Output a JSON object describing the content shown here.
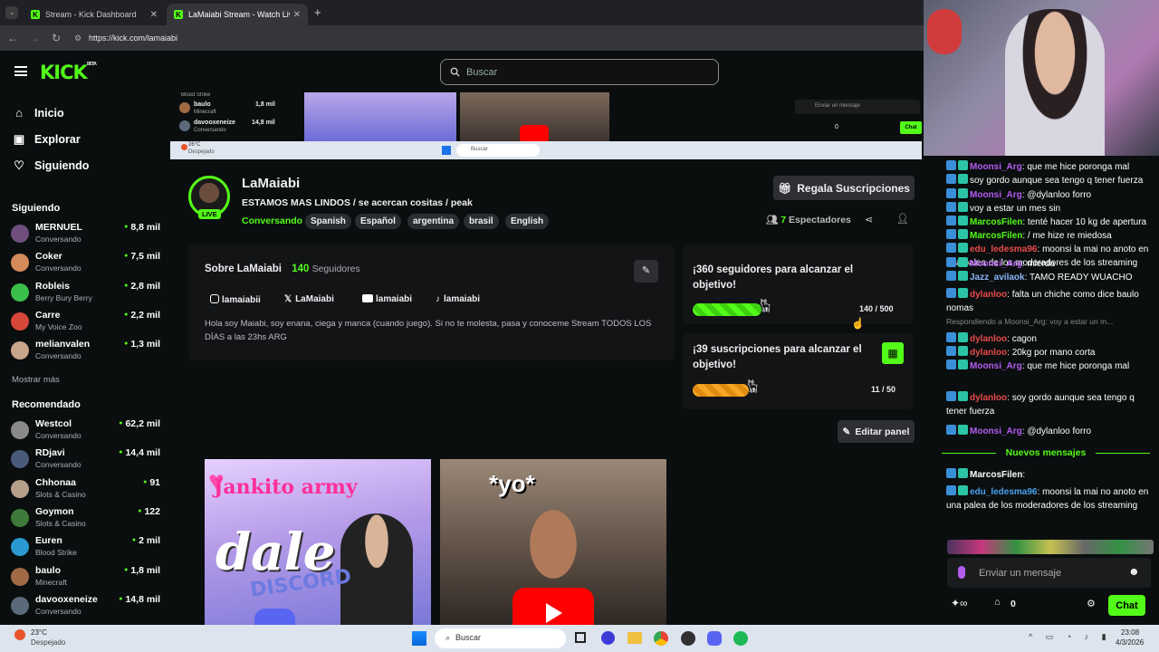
{
  "browser": {
    "tabs": [
      {
        "title": "Stream - Kick Dashboard"
      },
      {
        "title": "LaMaiabi Stream - Watch Live o"
      }
    ],
    "url": "https://kick.com/lamaiabi"
  },
  "header": {
    "logo": "KICK",
    "logo_sup": "BETA",
    "search_placeholder": "Buscar"
  },
  "nav": {
    "inicio": "Inicio",
    "explorar": "Explorar",
    "siguiendo": "Siguiendo"
  },
  "sidebar": {
    "following_title": "Siguiendo",
    "following": [
      {
        "name": "MERNUEL",
        "sub": "Conversando",
        "viewers": "8,8 mil",
        "color": "#6e4f7e"
      },
      {
        "name": "Coker",
        "sub": "Conversando",
        "viewers": "7,5 mil",
        "color": "#d58a5a"
      },
      {
        "name": "Robleis",
        "sub": "Berry Bury Berry",
        "viewers": "2,8 mil",
        "color": "#3bbf4b"
      },
      {
        "name": "Carre",
        "sub": "My Voice Zoo",
        "viewers": "2,2 mil",
        "color": "#d6473a"
      },
      {
        "name": "melianvalen",
        "sub": "Conversando",
        "viewers": "1,3 mil",
        "color": "#c9a58a"
      }
    ],
    "show_more": "Mostrar más",
    "recommended_title": "Recomendado",
    "recommended": [
      {
        "name": "Westcol",
        "sub": "Conversando",
        "viewers": "62,2 mil",
        "color": "#8a8a8a"
      },
      {
        "name": "RDjavi",
        "sub": "Conversando",
        "viewers": "14,4 mil",
        "color": "#4a5a7a"
      },
      {
        "name": "Chhonaa",
        "sub": "Slots & Casino",
        "viewers": "91",
        "color": "#b5a08a"
      },
      {
        "name": "Goymon",
        "sub": "Slots & Casino",
        "viewers": "122",
        "color": "#3e7a3a"
      },
      {
        "name": "Euren",
        "sub": "Blood Strike",
        "viewers": "2 mil",
        "color": "#2a9ad0"
      },
      {
        "name": "baulo",
        "sub": "Minecraft",
        "viewers": "1,8 mil",
        "color": "#a06a45"
      },
      {
        "name": "davooxeneize",
        "sub": "Conversando",
        "viewers": "14,8 mil",
        "color": "#5a6a7a"
      }
    ]
  },
  "inner": {
    "row1_sub": "Blood Strike",
    "row2_name": "baulo",
    "row2_sub": "Minecraft",
    "row2_vw": "1,8 mil",
    "row3_name": "davooxeneize",
    "row3_sub": "Conversando",
    "row3_vw": "14,8 mil",
    "chat_placeholder": "Enviar un mensaje",
    "chat_count": "0",
    "chat_btn": "Chat",
    "task_temp": "26°C",
    "task_weather": "Despejado",
    "task_search": "Buscar"
  },
  "stream": {
    "name": "LaMaiabi",
    "title": "ESTAMOS MAS LINDOS / se acercan cositas / peak",
    "category": "Conversando",
    "tags": [
      "Spanish",
      "Español",
      "argentina",
      "brasil",
      "English"
    ],
    "live": "LIVE",
    "gift_btn": "Regala Suscripciones",
    "viewers_count": "7",
    "viewers_label": "Espectadores"
  },
  "about": {
    "title": "Sobre LaMaiabi",
    "followers_count": "140",
    "followers_label": "Seguidores",
    "socials": [
      {
        "label": "lamaiabii"
      },
      {
        "label": "LaMaiabi"
      },
      {
        "label": "lamaiabi"
      },
      {
        "label": "lamaiabi"
      }
    ],
    "bio": "Hola soy Maiabi, soy enana, ciega y manca (cuando juego). Si no te molesta, pasa y conoceme Stream TODOS LOS DÍAS a las 23hs ARG"
  },
  "goals": [
    {
      "title": "¡360 seguidores para alcanzar el objetivo!",
      "progress": "140 / 500",
      "fraction": 0.28
    },
    {
      "title": "¡39 suscripciones para alcanzar el objetivo!",
      "progress": "11 / 50",
      "fraction": 0.22
    }
  ],
  "edit_panel": "Editar panel",
  "thumbs": [
    {
      "line1": "Jankito army",
      "line2": "dale",
      "line3": "DISCORD"
    },
    {
      "line1": "*yo*"
    }
  ],
  "chat": {
    "messages": [
      {
        "user": "Moonsi_Arg",
        "text": "que me hice poronga mal"
      },
      {
        "user": "",
        "text": "soy gordo aunque sea tengo q tener fuerza"
      },
      {
        "user": "Moonsi_Arg",
        "text": "@dylanloo forro"
      },
      {
        "user": "",
        "text": "voy a estar un mes sin"
      },
      {
        "user": "MarcosFilen",
        "text": "tenté hacer 10 kg de apertura"
      },
      {
        "user": "MarcosFilen",
        "text": "/ me hize re miedosa"
      },
      {
        "user": "edu_ledesma96",
        "text": "moonsi la mai no anoto en una palea de los moderadores de los streaming"
      },
      {
        "user": "Moonsi_Arg",
        "text": "mierda"
      },
      {
        "user": "Jazz_avilaok",
        "text": "TAMO READY WUACHO"
      },
      {
        "user": "dylanloo",
        "text": "falta un chiche como dice baulo nomas"
      },
      {
        "reply": "Respondiendo a Moonsi_Arg: voy a estar un m..."
      },
      {
        "user": "dylanloo",
        "text": "cagon"
      },
      {
        "user": "dylanloo",
        "text": "20kg por mano corta"
      },
      {
        "user": "Moonsi_Arg",
        "text": "que me hice poronga mal"
      },
      {
        "user": "dylanloo",
        "text": "soy gordo aunque sea tengo q tener fuerza"
      },
      {
        "user": "Moonsi_Arg",
        "text": "@dylanloo forro"
      },
      {
        "user": "MarcosFilen",
        "text": ""
      },
      {
        "user": "edu_ledesma96",
        "text": "moonsi la mai no anoto en una palea de los moderadores de los streaming"
      }
    ],
    "new_messages": "Nuevos mensajes",
    "input_placeholder": "Enviar un mensaje",
    "infinity_count": "0",
    "send_button": "Chat"
  },
  "taskbar": {
    "temp": "23°C",
    "weather": "Despejado",
    "search": "Buscar",
    "time": "23:08",
    "date": "4/3/2026"
  },
  "colors": {
    "accent": "#53fc18",
    "background": "#0b0e0f"
  }
}
